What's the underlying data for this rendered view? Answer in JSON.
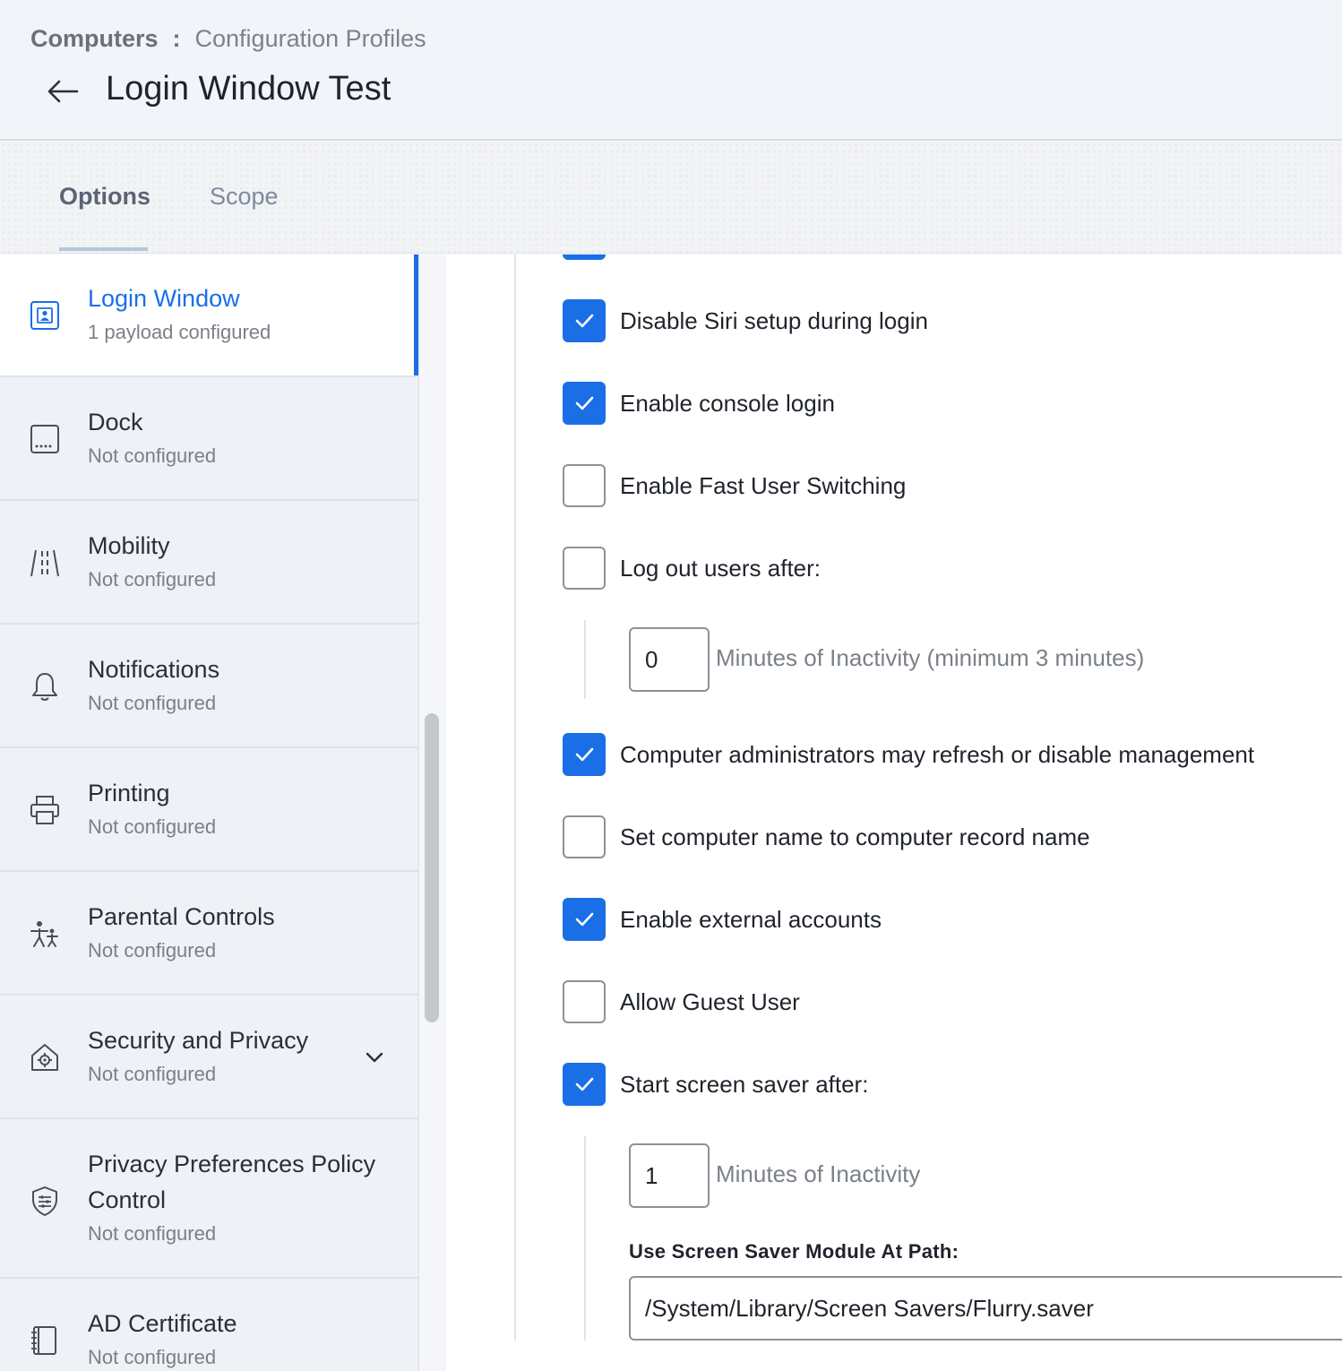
{
  "breadcrumb": {
    "root": "Computers",
    "separator": ":",
    "current": "Configuration Profiles"
  },
  "page": {
    "title": "Login Window Test"
  },
  "tabs": [
    {
      "label": "Options",
      "active": true
    },
    {
      "label": "Scope",
      "active": false
    }
  ],
  "sidebar": {
    "items": [
      {
        "title": "Login Window",
        "subtitle": "1 payload configured",
        "icon": "login-window-icon",
        "active": true
      },
      {
        "title": "Dock",
        "subtitle": "Not configured",
        "icon": "dock-icon"
      },
      {
        "title": "Mobility",
        "subtitle": "Not configured",
        "icon": "mobility-icon"
      },
      {
        "title": "Notifications",
        "subtitle": "Not configured",
        "icon": "bell-icon"
      },
      {
        "title": "Printing",
        "subtitle": "Not configured",
        "icon": "printer-icon"
      },
      {
        "title": "Parental Controls",
        "subtitle": "Not configured",
        "icon": "parental-controls-icon"
      },
      {
        "title": "Security and Privacy",
        "subtitle": "Not configured",
        "icon": "security-icon",
        "expandable": true
      },
      {
        "title_line1": "Privacy Preferences Policy",
        "title_line2": "Control",
        "subtitle": "Not configured",
        "icon": "shield-icon"
      },
      {
        "title": "AD Certificate",
        "subtitle": "Not configured",
        "icon": "certificate-icon"
      }
    ]
  },
  "options": [
    {
      "label": "Disable Siri setup during login",
      "checked": true
    },
    {
      "label": "Enable console login",
      "checked": true
    },
    {
      "label": "Enable Fast User Switching",
      "checked": false
    },
    {
      "label": "Log out users after:",
      "checked": false
    },
    {
      "label": "Computer administrators may refresh or disable management",
      "checked": true
    },
    {
      "label": "Set computer name to computer record name",
      "checked": false
    },
    {
      "label": "Enable external accounts",
      "checked": true
    },
    {
      "label": "Allow Guest User",
      "checked": false
    },
    {
      "label": "Start screen saver after:",
      "checked": true
    }
  ],
  "logout": {
    "value": "0",
    "hint": "Minutes of Inactivity (minimum 3 minutes)"
  },
  "screensaver": {
    "value": "1",
    "hint": "Minutes of Inactivity",
    "path_label": "Use Screen Saver Module At Path:",
    "path_value": "/System/Library/Screen Savers/Flurry.saver"
  },
  "colors": {
    "accent": "#1a6fe6",
    "sidebar_bg": "#eef1f5",
    "header_bg": "#f1f4f8"
  }
}
